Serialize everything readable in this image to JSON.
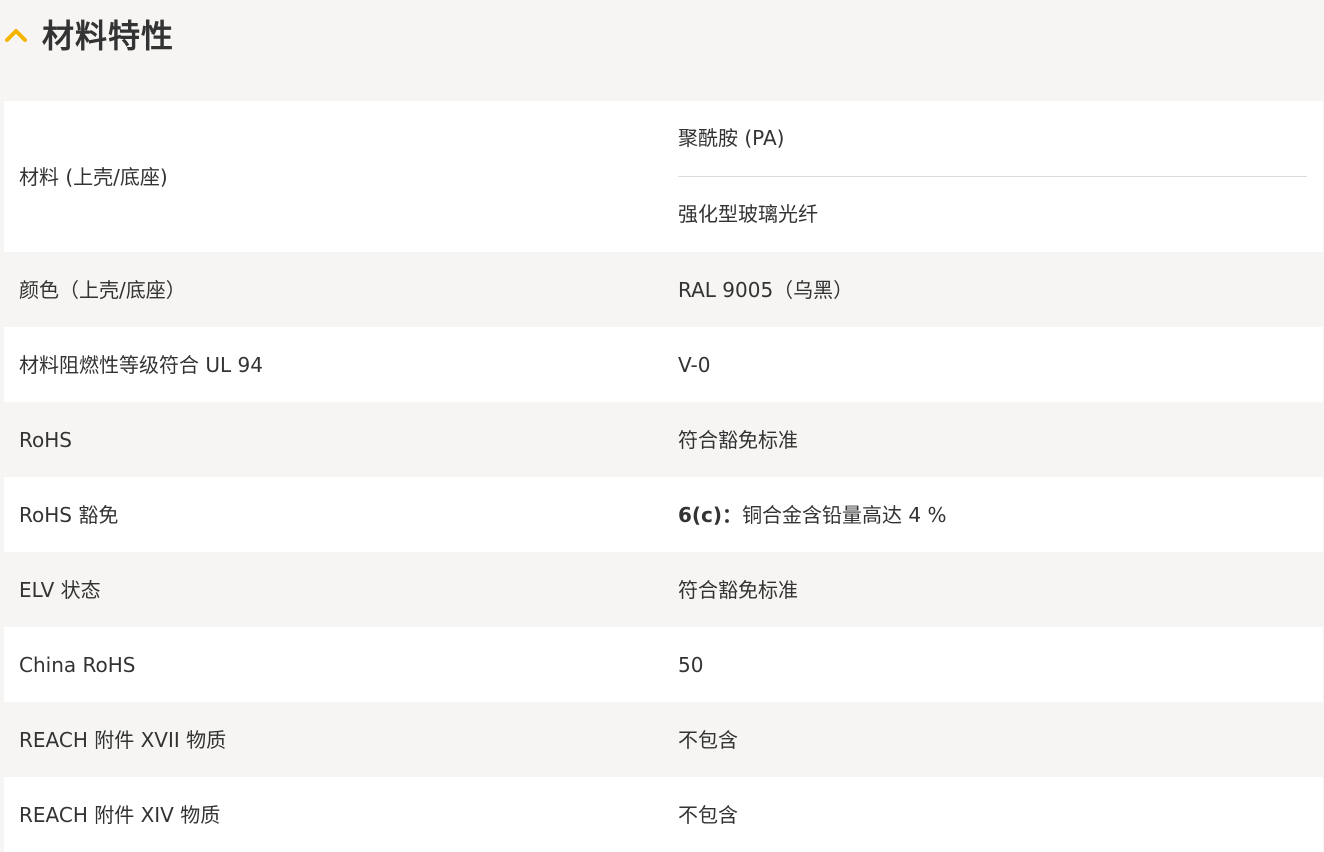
{
  "section": {
    "title": "材料特性",
    "icon": "chevron-up-icon",
    "accent_color": "#f5b400"
  },
  "rows": [
    {
      "label": "材料 (上壳/底座)",
      "values": [
        "聚酰胺 (PA)",
        "强化型玻璃光纤"
      ]
    },
    {
      "label": "颜色（上壳/底座）",
      "value": "RAL 9005（乌黑）"
    },
    {
      "label": "材料阻燃性等级符合 UL 94",
      "value": "V-0"
    },
    {
      "label": "RoHS",
      "value": "符合豁免标准"
    },
    {
      "label": "RoHS 豁免",
      "value_bold": "6(c)：",
      "value": "铜合金含铅量高达 4 %"
    },
    {
      "label": "ELV 状态",
      "value": "符合豁免标准"
    },
    {
      "label": "China RoHS",
      "value": "50"
    },
    {
      "label": "REACH 附件 XVII 物质",
      "value": "不包含"
    },
    {
      "label": "REACH 附件 XIV 物质",
      "value": "不包含"
    }
  ]
}
